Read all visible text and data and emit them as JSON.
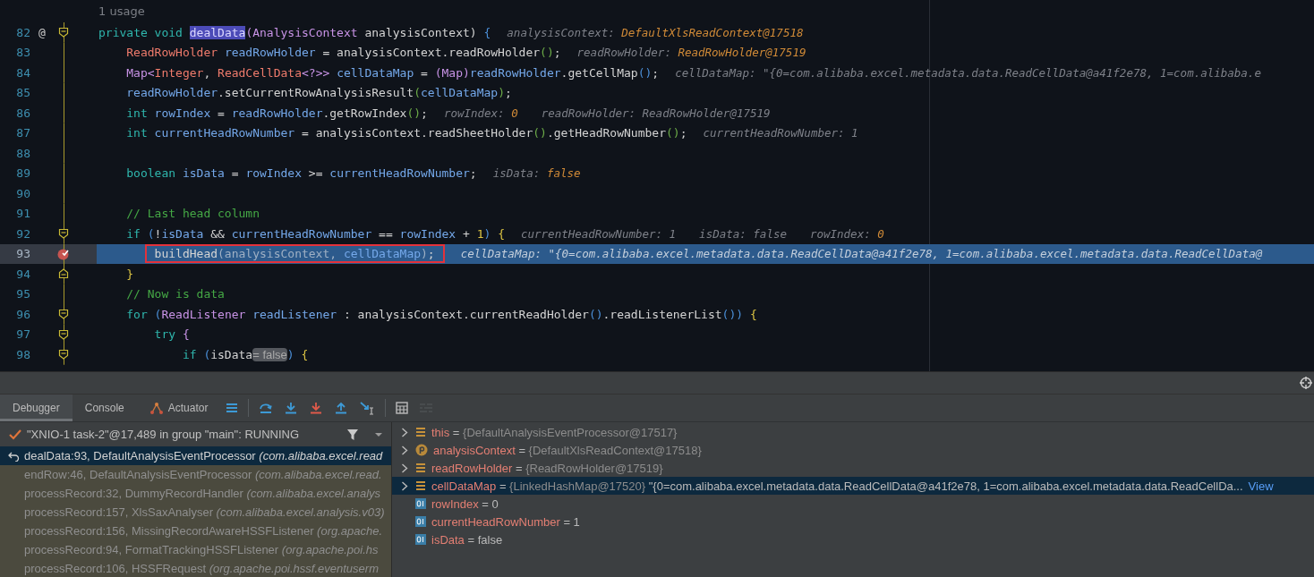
{
  "editor": {
    "usage_hint": "1 usage",
    "lines": [
      {
        "number": "82",
        "gutter_symbol": "@",
        "marker": {
          "kind": "fold-start"
        },
        "current": false,
        "framed": false,
        "tokens": [
          {
            "text": "private void ",
            "kind": "kw"
          },
          {
            "text": "dealData",
            "kind": "usage"
          },
          {
            "text": "(AnalysisContext ",
            "kind": "type2"
          },
          {
            "text": "analysisContext",
            "kind": "plain"
          },
          {
            "text": ") ",
            "kind": "plain"
          },
          {
            "text": "{",
            "kind": "p2"
          }
        ],
        "hints": [
          {
            "label": "analysisContext: ",
            "value": "DefaultXlsReadContext@17518",
            "kind": "value"
          }
        ],
        "children": [
          {
            "number": "83",
            "current": false,
            "framed": false,
            "tokens": [
              {
                "text": "ReadRowHolder ",
                "kind": "type"
              },
              {
                "text": "readRowHolder",
                "kind": "var"
              },
              {
                "text": " = analysisContext.readRowHolder",
                "kind": "plain"
              },
              {
                "text": "()",
                "kind": "p1"
              },
              {
                "text": ";",
                "kind": "plain"
              }
            ],
            "hints": [
              {
                "label": "readRowHolder: ",
                "value": "ReadRowHolder@17519",
                "kind": "value"
              }
            ]
          },
          {
            "number": "84",
            "current": false,
            "framed": false,
            "tokens": [
              {
                "text": "Map<",
                "kind": "type2"
              },
              {
                "text": "Integer",
                "kind": "type"
              },
              {
                "text": ", ",
                "kind": "plain"
              },
              {
                "text": "ReadCellData",
                "kind": "type"
              },
              {
                "text": "<?>> ",
                "kind": "type2"
              },
              {
                "text": "cellDataMap",
                "kind": "var"
              },
              {
                "text": " = ",
                "kind": "plain"
              },
              {
                "text": "(Map)",
                "kind": "type2"
              },
              {
                "text": "readRowHolder",
                "kind": "var"
              },
              {
                "text": ".getCellMap",
                "kind": "plain"
              },
              {
                "text": "()",
                "kind": "p2"
              },
              {
                "text": ";",
                "kind": "plain"
              }
            ],
            "hints": [
              {
                "label": "cellDataMap: ",
                "value": "\"{0=com.alibaba.excel.metadata.data.ReadCellData@a41f2e78, 1=com.alibaba.e",
                "kind": "text"
              }
            ]
          },
          {
            "number": "85",
            "current": false,
            "framed": false,
            "tokens": [
              {
                "text": "readRowHolder",
                "kind": "var"
              },
              {
                "text": ".setCurrentRowAnalysisResult",
                "kind": "plain"
              },
              {
                "text": "(",
                "kind": "p1"
              },
              {
                "text": "cellDataMap",
                "kind": "var"
              },
              {
                "text": ")",
                "kind": "p1"
              },
              {
                "text": ";",
                "kind": "plain"
              }
            ]
          },
          {
            "number": "86",
            "current": false,
            "framed": false,
            "tokens": [
              {
                "text": "int ",
                "kind": "kw"
              },
              {
                "text": "rowIndex",
                "kind": "var"
              },
              {
                "text": " = ",
                "kind": "plain"
              },
              {
                "text": "readRowHolder",
                "kind": "var"
              },
              {
                "text": ".getRowIndex",
                "kind": "plain"
              },
              {
                "text": "()",
                "kind": "p1"
              },
              {
                "text": ";",
                "kind": "plain"
              }
            ],
            "hints": [
              {
                "label": "rowIndex: ",
                "value": "0",
                "kind": "value"
              },
              {
                "label": "readRowHolder: ",
                "value": "ReadRowHolder@17519",
                "kind": "text"
              }
            ]
          },
          {
            "number": "87",
            "current": false,
            "framed": false,
            "tokens": [
              {
                "text": "int ",
                "kind": "kw"
              },
              {
                "text": "currentHeadRowNumber",
                "kind": "var"
              },
              {
                "text": " = analysisContext.readSheetHolder",
                "kind": "plain"
              },
              {
                "text": "()",
                "kind": "p1"
              },
              {
                "text": ".getHeadRowNumber",
                "kind": "plain"
              },
              {
                "text": "()",
                "kind": "p1"
              },
              {
                "text": ";",
                "kind": "plain"
              }
            ],
            "hints": [
              {
                "label": "currentHeadRowNumber: ",
                "value": "1",
                "kind": "text"
              }
            ]
          },
          {
            "number": "88",
            "current": false
          },
          {
            "number": "89",
            "current": false,
            "framed": false,
            "tokens": [
              {
                "text": "boolean ",
                "kind": "kw"
              },
              {
                "text": "isData",
                "kind": "var"
              },
              {
                "text": " = ",
                "kind": "plain"
              },
              {
                "text": "rowIndex",
                "kind": "var"
              },
              {
                "text": " >= ",
                "kind": "plain"
              },
              {
                "text": "currentHeadRowNumber",
                "kind": "var"
              },
              {
                "text": ";",
                "kind": "plain"
              }
            ],
            "hints": [
              {
                "label": "isData: ",
                "value": "false",
                "kind": "value"
              }
            ]
          },
          {
            "number": "90",
            "current": false
          },
          {
            "number": "91",
            "current": false,
            "framed": false,
            "tokens": [
              {
                "text": "// Last head column",
                "kind": "comment"
              }
            ]
          },
          {
            "number": "92",
            "marker": {
              "kind": "fold-start"
            },
            "current": false,
            "framed": false,
            "tokens": [
              {
                "text": "if ",
                "kind": "kw"
              },
              {
                "text": "(",
                "kind": "p2"
              },
              {
                "text": "!",
                "kind": "plain"
              },
              {
                "text": "isData",
                "kind": "var"
              },
              {
                "text": " && ",
                "kind": "plain"
              },
              {
                "text": "currentHeadRowNumber",
                "kind": "var"
              },
              {
                "text": " == ",
                "kind": "plain"
              },
              {
                "text": "rowIndex",
                "kind": "var"
              },
              {
                "text": " + ",
                "kind": "plain"
              },
              {
                "text": "1",
                "kind": "num"
              },
              {
                "text": ") ",
                "kind": "p2"
              },
              {
                "text": "{",
                "kind": "p3"
              }
            ],
            "hints": [
              {
                "label": "currentHeadRowNumber: ",
                "value": "1",
                "kind": "text"
              },
              {
                "label": "isData: ",
                "value": "false",
                "kind": "text"
              },
              {
                "label": "rowIndex: ",
                "value": "0",
                "kind": "value"
              }
            ],
            "children": [
              {
                "number": "93",
                "marker": {
                  "kind": "breakpoint"
                },
                "current": true,
                "framed": true,
                "tokens": [
                  {
                    "text": "buildHead",
                    "kind": "plain"
                  },
                  {
                    "text": "(analysisContext, ",
                    "kind": "muted"
                  },
                  {
                    "text": "cellDataMap",
                    "kind": "var"
                  },
                  {
                    "text": ")",
                    "kind": "muted"
                  },
                  {
                    "text": ";",
                    "kind": "plain"
                  }
                ],
                "hints": [
                  {
                    "label": "cellDataMap: ",
                    "value": "\"{0=com.alibaba.excel.metadata.data.ReadCellData@a41f2e78, 1=com.alibaba.excel.metadata.data.ReadCellData@",
                    "kind": "text"
                  }
                ]
              }
            ]
          },
          {
            "number": "94",
            "marker": {
              "kind": "fold-end"
            },
            "current": false,
            "framed": false,
            "tokens": [
              {
                "text": "}",
                "kind": "p3"
              }
            ]
          },
          {
            "number": "95",
            "current": false,
            "framed": false,
            "tokens": [
              {
                "text": "// Now is data",
                "kind": "comment"
              }
            ]
          },
          {
            "number": "96",
            "marker": {
              "kind": "fold-start"
            },
            "current": false,
            "framed": false,
            "tokens": [
              {
                "text": "for ",
                "kind": "kw"
              },
              {
                "text": "(",
                "kind": "p2"
              },
              {
                "text": "ReadListener ",
                "kind": "type2"
              },
              {
                "text": "readListener",
                "kind": "var"
              },
              {
                "text": " : analysisContext.currentReadHolder",
                "kind": "plain"
              },
              {
                "text": "()",
                "kind": "p2"
              },
              {
                "text": ".readListenerList",
                "kind": "plain"
              },
              {
                "text": "()",
                "kind": "p2"
              },
              {
                "text": ")",
                "kind": "p2"
              },
              {
                "text": " {",
                "kind": "p3"
              }
            ],
            "children": [
              {
                "number": "97",
                "marker": {
                  "kind": "fold-start"
                },
                "current": false,
                "framed": false,
                "tokens": [
                  {
                    "text": "try ",
                    "kind": "kw"
                  },
                  {
                    "text": "{",
                    "kind": "type2"
                  }
                ],
                "children": [
                  {
                    "number": "98",
                    "marker": {
                      "kind": "fold-start"
                    },
                    "current": false,
                    "framed": false,
                    "tokens": [
                      {
                        "text": "if ",
                        "kind": "kw"
                      },
                      {
                        "text": "(",
                        "kind": "p2"
                      },
                      {
                        "text": "isData",
                        "kind": "plain"
                      },
                      {
                        "text": "= false",
                        "kind": "pill"
                      },
                      {
                        "text": ")",
                        "kind": "p2"
                      },
                      {
                        "text": " {",
                        "kind": "p3"
                      }
                    ]
                  }
                ]
              }
            ]
          }
        ]
      }
    ]
  },
  "debugger": {
    "tabs": [
      {
        "label": "Debugger",
        "selected": true,
        "has_icon": false
      },
      {
        "label": "Console",
        "selected": false,
        "has_icon": false
      },
      {
        "label": "Actuator",
        "selected": false,
        "has_icon": true
      }
    ],
    "toolbar_groups": [
      {
        "buttons": [
          {
            "kind": "list",
            "disabled": false
          }
        ]
      },
      {
        "buttons": [
          {
            "kind": "step-over",
            "disabled": false
          },
          {
            "kind": "step-into",
            "disabled": false
          },
          {
            "kind": "force-step-into",
            "disabled": false
          },
          {
            "kind": "step-out",
            "disabled": false
          },
          {
            "kind": "run-to-cursor",
            "disabled": false
          }
        ]
      },
      {
        "buttons": [
          {
            "kind": "evaluate",
            "disabled": false
          },
          {
            "kind": "trace",
            "disabled": true
          }
        ]
      }
    ],
    "thread": {
      "label": "\"XNIO-1 task-2\"@17,489 in group \"main\": RUNNING"
    },
    "frames": [
      {
        "method": "dealData:93, DefaultAnalysisEventProcessor ",
        "location": "(com.alibaba.excel.read",
        "selected": true,
        "library": false
      },
      {
        "method": "endRow:46, DefaultAnalysisEventProcessor ",
        "location": "(com.alibaba.excel.read.",
        "selected": false,
        "library": true
      },
      {
        "method": "processRecord:32, DummyRecordHandler ",
        "location": "(com.alibaba.excel.analys",
        "selected": false,
        "library": true
      },
      {
        "method": "processRecord:157, XlsSaxAnalyser ",
        "location": "(com.alibaba.excel.analysis.v03)",
        "selected": false,
        "library": true
      },
      {
        "method": "processRecord:156, MissingRecordAwareHSSFListener ",
        "location": "(org.apache.",
        "selected": false,
        "library": true
      },
      {
        "method": "processRecord:94, FormatTrackingHSSFListener ",
        "location": "(org.apache.poi.hs",
        "selected": false,
        "library": true
      },
      {
        "method": "processRecord:106, HSSFRequest ",
        "location": "(org.apache.poi.hssf.eventuserm",
        "selected": false,
        "library": true
      }
    ],
    "variables": [
      {
        "name": "this",
        "operator": "=",
        "value": "{DefaultAnalysisEventProcessor@17517}",
        "kind": "field",
        "expandable": true,
        "selected": false
      },
      {
        "name": "analysisContext",
        "operator": "=",
        "value": "{DefaultXlsReadContext@17518}",
        "kind": "param",
        "expandable": true,
        "selected": false
      },
      {
        "name": "readRowHolder",
        "operator": "=",
        "value": "{ReadRowHolder@17519}",
        "kind": "field",
        "expandable": true,
        "selected": false
      },
      {
        "name": "cellDataMap",
        "operator": "=",
        "value": "{LinkedHashMap@17520}",
        "detail": "\"{0=com.alibaba.excel.metadata.data.ReadCellData@a41f2e78, 1=com.alibaba.excel.metadata.data.ReadCellDa...",
        "link": "View",
        "kind": "field",
        "expandable": true,
        "selected": true
      },
      {
        "name": "rowIndex",
        "operator": "=",
        "value": "0",
        "kind": "primitive",
        "expandable": false,
        "selected": false
      },
      {
        "name": "currentHeadRowNumber",
        "operator": "=",
        "value": "1",
        "kind": "primitive",
        "expandable": false,
        "selected": false
      },
      {
        "name": "isData",
        "operator": "=",
        "value": "false",
        "kind": "primitive",
        "expandable": false,
        "selected": false
      }
    ]
  }
}
